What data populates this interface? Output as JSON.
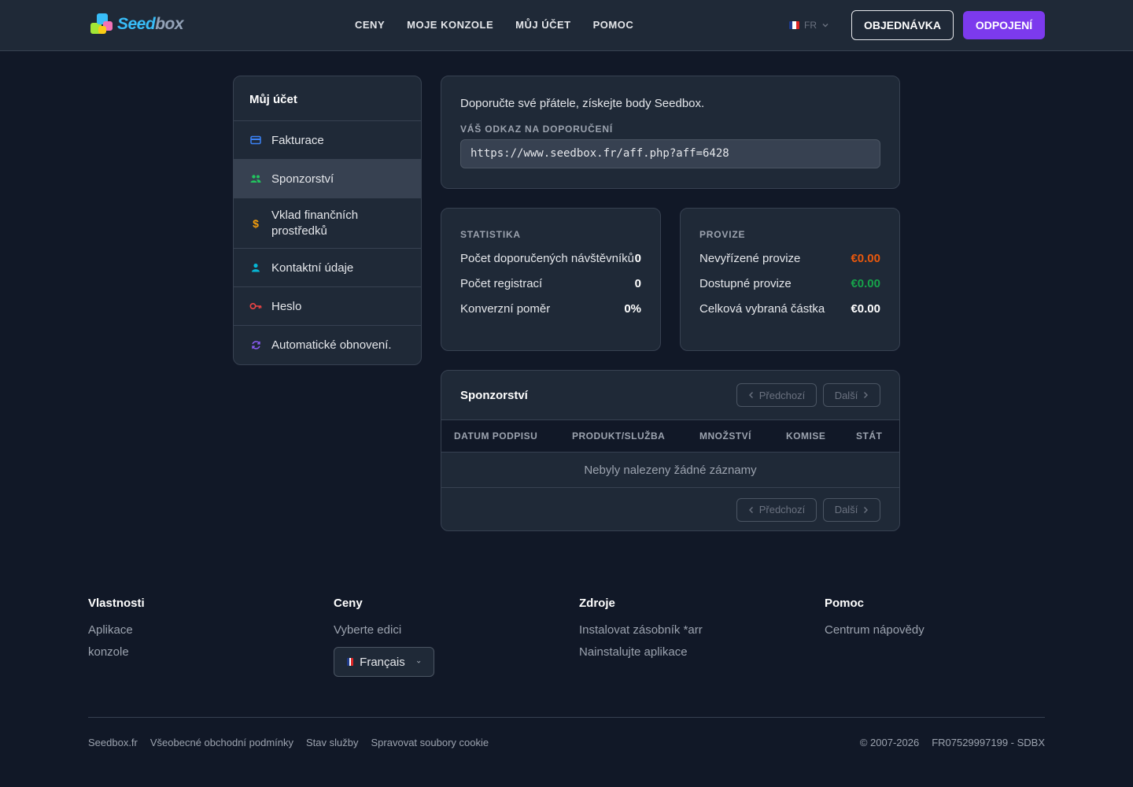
{
  "header": {
    "logo": {
      "seed": "Seed",
      "box": "box"
    },
    "nav": [
      "CENY",
      "MOJE KONZOLE",
      "MŮJ ÚČET",
      "POMOC"
    ],
    "lang": "FR",
    "order_label": "OBJEDNÁVKA",
    "logout_label": "ODPOJENÍ"
  },
  "sidebar": {
    "title": "Můj účet",
    "items": [
      {
        "label": "Fakturace",
        "icon": "credit-card-icon"
      },
      {
        "label": "Sponzorství",
        "icon": "users-icon",
        "active": true
      },
      {
        "label": "Vklad finančních prostředků",
        "icon": "dollar-icon"
      },
      {
        "label": "Kontaktní údaje",
        "icon": "user-icon"
      },
      {
        "label": "Heslo",
        "icon": "key-icon"
      },
      {
        "label": "Automatické obnovení.",
        "icon": "refresh-icon"
      }
    ]
  },
  "referral": {
    "intro": "Doporučte své přátele, získejte body Seedbox.",
    "link_label": "VÁŠ ODKAZ NA DOPORUČENÍ",
    "link_value": "https://www.seedbox.fr/aff.php?aff=6428"
  },
  "stats": {
    "title": "STATISTIKA",
    "rows": [
      {
        "label": "Počet doporučených návštěvníků",
        "value": "0"
      },
      {
        "label": "Počet registrací",
        "value": "0"
      },
      {
        "label": "Konverzní poměr",
        "value": "0%"
      }
    ]
  },
  "commissions": {
    "title": "PROVIZE",
    "rows": [
      {
        "label": "Nevyřízené provize",
        "value": "€0.00"
      },
      {
        "label": "Dostupné provize",
        "value": "€0.00"
      },
      {
        "label": "Celková vybraná částka",
        "value": "€0.00"
      }
    ]
  },
  "sponsorship_table": {
    "title": "Sponzorství",
    "prev_label": "Předchozí",
    "next_label": "Další",
    "columns": [
      "DATUM PODPISU",
      "PRODUKT/SLUŽBA",
      "MNOŽSTVÍ",
      "KOMISE",
      "STÁT"
    ],
    "empty_text": "Nebyly nalezeny žádné záznamy"
  },
  "footer": {
    "columns": [
      {
        "title": "Vlastnosti",
        "links": [
          "Aplikace",
          "konzole"
        ]
      },
      {
        "title": "Ceny",
        "links": [
          "Vyberte edici"
        ]
      },
      {
        "title": "Zdroje",
        "links": [
          "Instalovat zásobník *arr",
          "Nainstalujte aplikace"
        ]
      },
      {
        "title": "Pomoc",
        "links": [
          "Centrum nápovědy"
        ]
      }
    ],
    "language_select": "Français",
    "bottom_links": [
      "Seedbox.fr",
      "Všeobecné obchodní podmínky",
      "Stav služby",
      "Spravovat soubory cookie"
    ],
    "copyright": "© 2007-2026",
    "company_id": "FR07529997199 - SDBX"
  },
  "colors": {
    "accent": "#7c3aed",
    "pending": "#ea580c",
    "available": "#16a34a"
  }
}
